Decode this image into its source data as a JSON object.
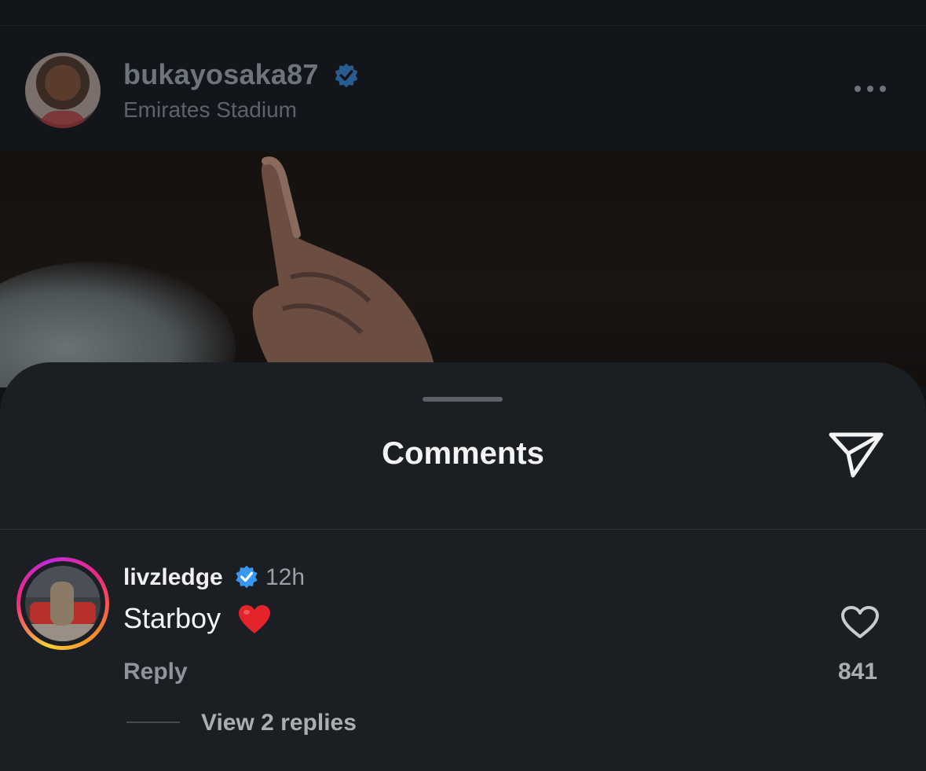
{
  "post": {
    "username": "bukayosaka87",
    "location": "Emirates Stadium",
    "verified_icon": "verified-badge-icon",
    "more_icon": "more-horizontal-icon"
  },
  "sheet": {
    "title": "Comments",
    "share_icon": "send-icon"
  },
  "comment": {
    "username": "livzledge",
    "time": "12h",
    "text": "Starboy",
    "emoji": "red-heart-emoji",
    "reply_label": "Reply",
    "like_count": "841",
    "view_replies": "View 2 replies"
  },
  "colors": {
    "verified": "#3897f0",
    "sheet_bg": "#1b1e22",
    "header_bg": "#12161b"
  }
}
